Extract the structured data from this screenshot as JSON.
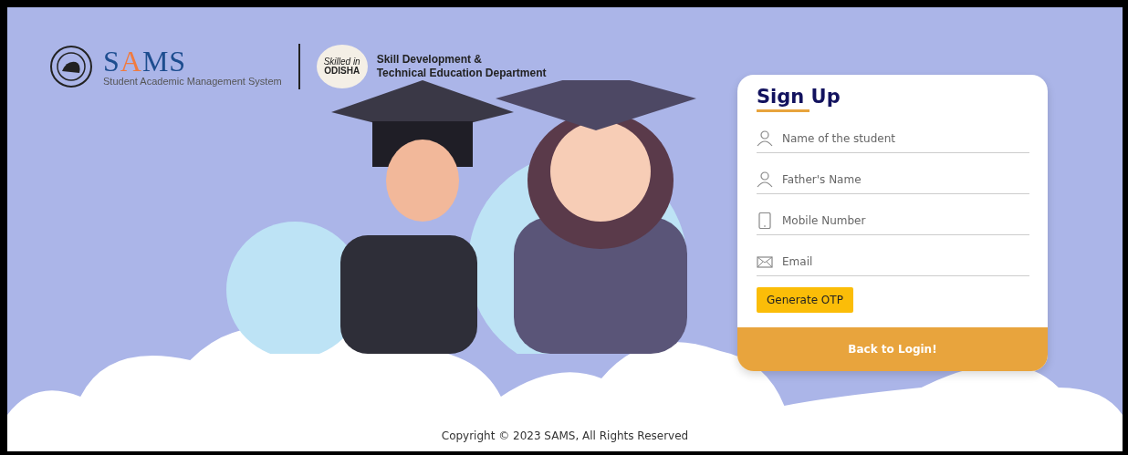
{
  "header": {
    "logo": {
      "text": "SAMS",
      "subtitle": "Student Academic Management System"
    },
    "partner": {
      "badge_top": "Skilled in",
      "badge_bottom": "ODISHA",
      "name_line_1": "Skill Development &",
      "name_line_2": "Technical Education Department"
    }
  },
  "signup": {
    "title": "Sign Up",
    "fields": [
      {
        "kind": "person",
        "placeholder": "Name of the student"
      },
      {
        "kind": "person",
        "placeholder": "Father's Name"
      },
      {
        "kind": "phone",
        "placeholder": "Mobile Number"
      },
      {
        "kind": "mail",
        "placeholder": "Email"
      }
    ],
    "otp_button": "Generate OTP",
    "back_button": "Back to Login!"
  },
  "footer": "Copyright © 2023 SAMS, All Rights Reserved"
}
